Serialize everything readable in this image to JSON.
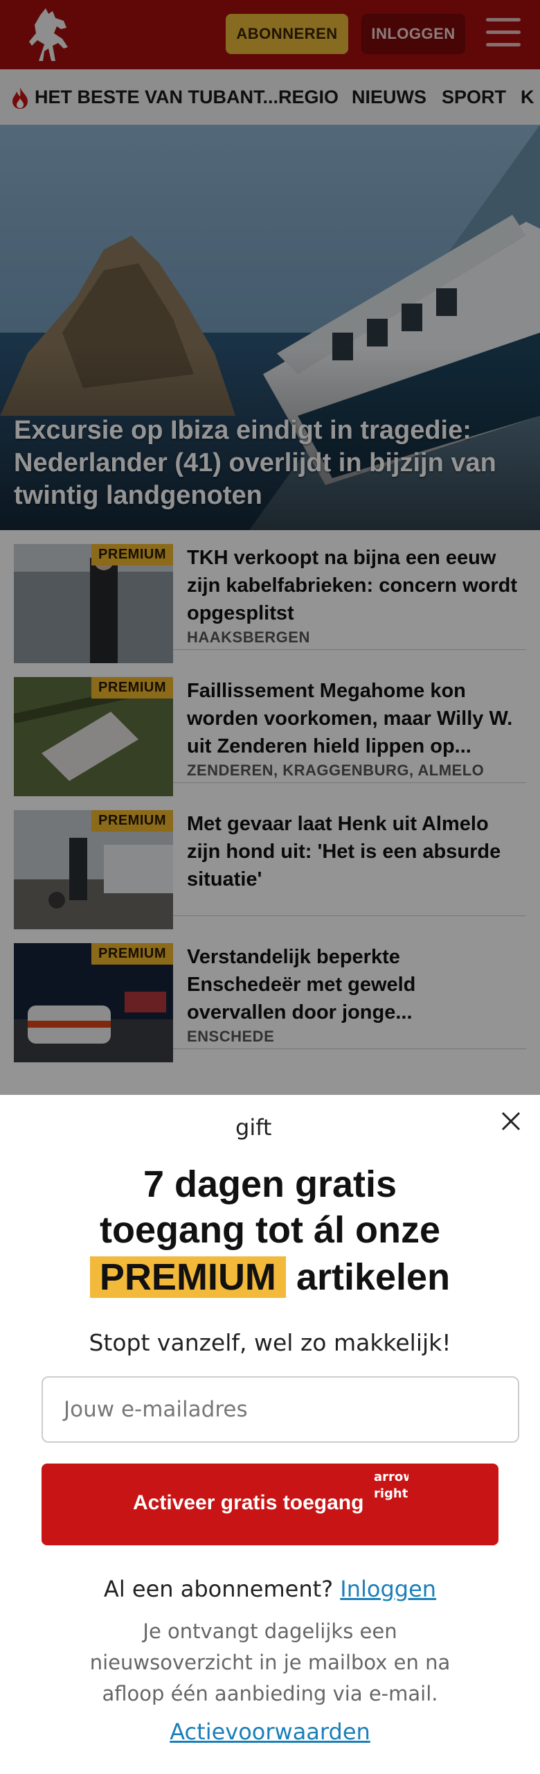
{
  "header": {
    "subscribe_label": "ABONNEREN",
    "login_label": "INLOGGEN",
    "brand_color": "#a50f0f"
  },
  "nav": {
    "items": [
      {
        "label": "HET BESTE VAN TUBANT...",
        "icon": "flame-icon"
      },
      {
        "label": "REGIO"
      },
      {
        "label": "NIEUWS"
      },
      {
        "label": "SPORT"
      },
      {
        "label": "K"
      }
    ]
  },
  "hero": {
    "title": "Excursie op Ibiza eindigt in tragedie: Nederlander (41) overlijdt in bijzijn van twintig landgenoten"
  },
  "articles": [
    {
      "badge": "PREMIUM",
      "title": "TKH verkoopt na bijna een eeuw zijn kabelfabrieken: concern wordt opgesplitst",
      "location": "HAAKSBERGEN"
    },
    {
      "badge": "PREMIUM",
      "title": "Faillissement Megahome kon worden voorkomen, maar Willy W. uit Zenderen hield lippen op...",
      "location": "ZENDEREN, KRAGGENBURG, ALMELO"
    },
    {
      "badge": "PREMIUM",
      "title": "Met gevaar laat Henk uit Almelo zijn hond uit: 'Het is een absurde situatie'",
      "location": ""
    },
    {
      "badge": "PREMIUM",
      "title": "Verstandelijk beperkte Enschedeër met geweld overvallen door jonge...",
      "location": "ENSCHEDE"
    }
  ],
  "modal": {
    "gift_alt": "gift",
    "title_line1": "7 dagen gratis",
    "title_line2": "toegang tot ál onze",
    "title_highlight": "PREMIUM",
    "title_line3_rest": "artikelen",
    "subtitle": "Stopt vanzelf, wel zo makkelijk!",
    "email_placeholder": "Jouw e-mailadres",
    "cta_label": "Activeer gratis toegang",
    "cta_arrow_alt": "arrow right",
    "login_prompt": "Al een abonnement?",
    "login_link": "Inloggen",
    "info": "Je ontvangt dagelijks een nieuwsoverzicht in je mailbox en na afloop één aanbieding via e-mail.",
    "terms_link": "Actievoorwaarden",
    "accent_color": "#c81414",
    "highlight_color": "#f3b93b"
  }
}
